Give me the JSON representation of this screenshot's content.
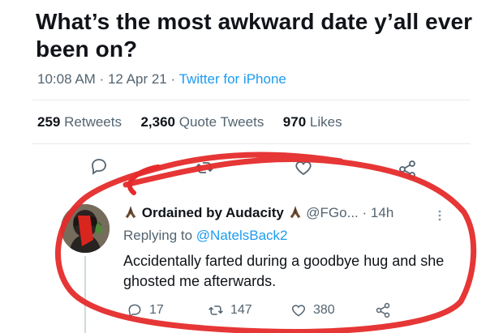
{
  "tweet": {
    "text": "What’s the most awkward date y’all ever been on?",
    "time": "10:08 AM",
    "date": "12 Apr 21",
    "source": "Twitter for iPhone",
    "retweets_count": "259",
    "retweets_label": "Retweets",
    "quotes_count": "2,360",
    "quotes_label": "Quote Tweets",
    "likes_count": "970",
    "likes_label": "Likes",
    "separator": "·"
  },
  "reply": {
    "display_name": "Ordained by Audacity",
    "handle": "@FGo...",
    "time": "14h",
    "replying_prefix": "Replying to",
    "replying_to": "@NatelsBack2",
    "text": "Accidentally farted during a goodbye hug and she ghosted me afterwards.",
    "reply_count": "17",
    "retweet_count": "147",
    "like_count": "380"
  },
  "icons": {
    "reply": "reply-icon",
    "retweet": "retweet-icon",
    "like": "heart-icon",
    "share": "share-icon",
    "more": "more-icon",
    "avatar": "avatar-image",
    "praying_hands": "praying-hands-icon"
  },
  "colors": {
    "accent": "#1d9bf0",
    "muted": "#536471",
    "scribble": "#e52b2b"
  }
}
